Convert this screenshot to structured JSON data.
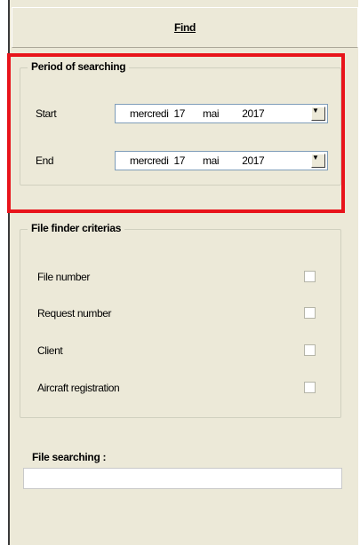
{
  "header": {
    "find_label": "Find"
  },
  "period": {
    "title": "Period of searching",
    "start": {
      "label": "Start",
      "weekday": "mercredi",
      "day": "17",
      "month": "mai",
      "year": "2017"
    },
    "end": {
      "label": "End",
      "weekday": "mercredi",
      "day": "17",
      "month": "mai",
      "year": "2017"
    }
  },
  "criteria": {
    "title": "File finder criterias",
    "items": [
      {
        "label": "File number",
        "checked": false
      },
      {
        "label": "Request number",
        "checked": false
      },
      {
        "label": "Client",
        "checked": false
      },
      {
        "label": "Aircraft registration",
        "checked": false
      }
    ]
  },
  "search": {
    "label": "File searching :",
    "value": ""
  },
  "colors": {
    "highlight": "#e8141b",
    "panel": "#ece9d8"
  },
  "icons": {
    "dropdown": "chevron-down-icon"
  }
}
